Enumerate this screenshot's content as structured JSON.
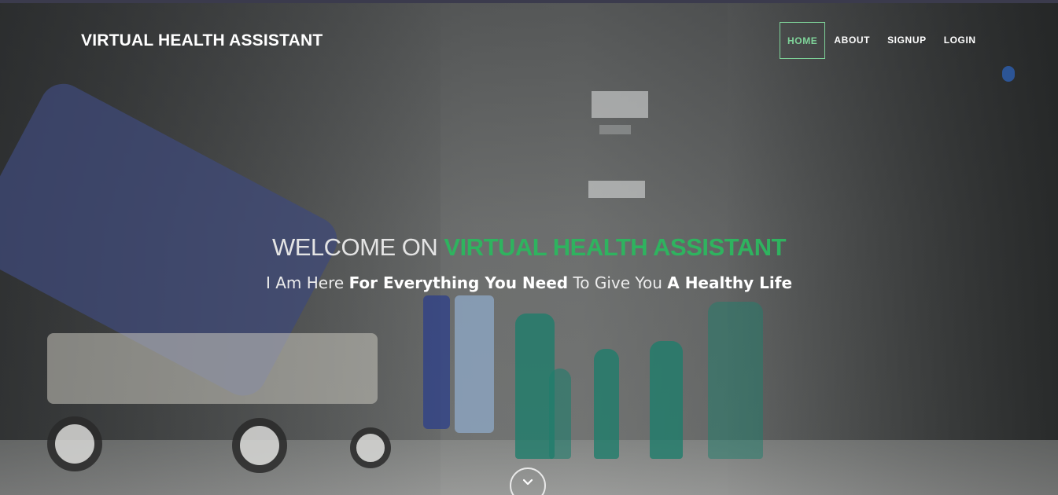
{
  "navbar": {
    "brand": "VIRTUAL HEALTH ASSISTANT",
    "links": [
      {
        "label": "HOME",
        "active": true
      },
      {
        "label": "ABOUT",
        "active": false
      },
      {
        "label": "SIGNUP",
        "active": false
      },
      {
        "label": "LOGIN",
        "active": false
      }
    ]
  },
  "hero": {
    "title_prefix": "WELCOME ON",
    "title_accent": "VIRTUAL HEALTH ASSISTANT",
    "subtitle_1": "I Am Here",
    "subtitle_2": "For Everything You Need",
    "subtitle_3": "To Give You",
    "subtitle_4": "A Healthy Life",
    "scroll_icon": "chevron-down-icon"
  },
  "colors": {
    "accent_green": "#2fb35f",
    "nav_active": "#7fd49a",
    "text_light": "#ffffff"
  }
}
